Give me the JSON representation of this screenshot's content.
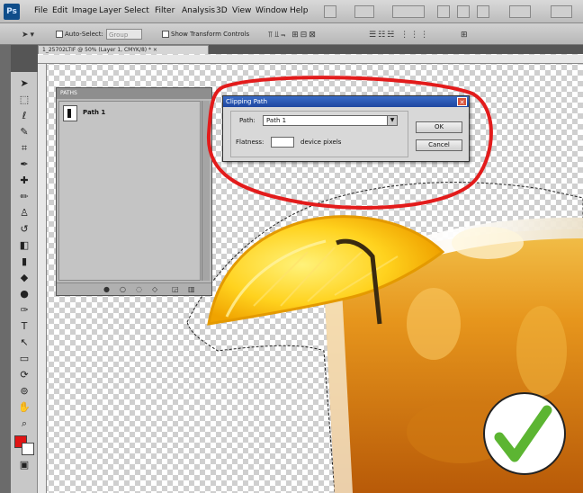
{
  "menu": {
    "logo": "Ps",
    "items": [
      "File",
      "Edit",
      "Image",
      "Layer",
      "Select",
      "Filter",
      "Analysis",
      "3D",
      "View",
      "Window",
      "Help"
    ]
  },
  "options_bar": {
    "auto_select_label": "Auto-Select:",
    "auto_select_value": "Group",
    "show_transform_label": "Show Transform Controls"
  },
  "document": {
    "tab_title": "1_25702LTIF @ 50% (Layer 1, CMYK/8) * ×"
  },
  "paths_panel": {
    "title": "PATHS",
    "items": [
      {
        "name": "Path 1"
      }
    ]
  },
  "dialog": {
    "title": "Clipping Path",
    "path_label": "Path:",
    "path_value": "Path 1",
    "flatness_label": "Flatness:",
    "flatness_value": "",
    "units_label": "device pixels",
    "ok_label": "OK",
    "cancel_label": "Cancel"
  },
  "colors": {
    "annotation_red": "#e31b1b",
    "checkmark_green": "#5cb532",
    "foreground": "#e01414",
    "background": "#ffffff",
    "dialog_titlebar": "#2a56b4"
  },
  "icons": {
    "tools": [
      "move-icon",
      "marquee-icon",
      "lasso-icon",
      "magic-wand-icon",
      "crop-icon",
      "eyedropper-icon",
      "healing-brush-icon",
      "brush-icon",
      "clone-stamp-icon",
      "history-brush-icon",
      "eraser-icon",
      "gradient-icon",
      "blur-icon",
      "dodge-icon",
      "pen-icon",
      "type-icon",
      "path-select-icon",
      "shape-icon",
      "3d-rotate-icon",
      "3d-orbit-icon",
      "hand-icon",
      "zoom-icon"
    ],
    "confirm": "checkmark-icon"
  }
}
